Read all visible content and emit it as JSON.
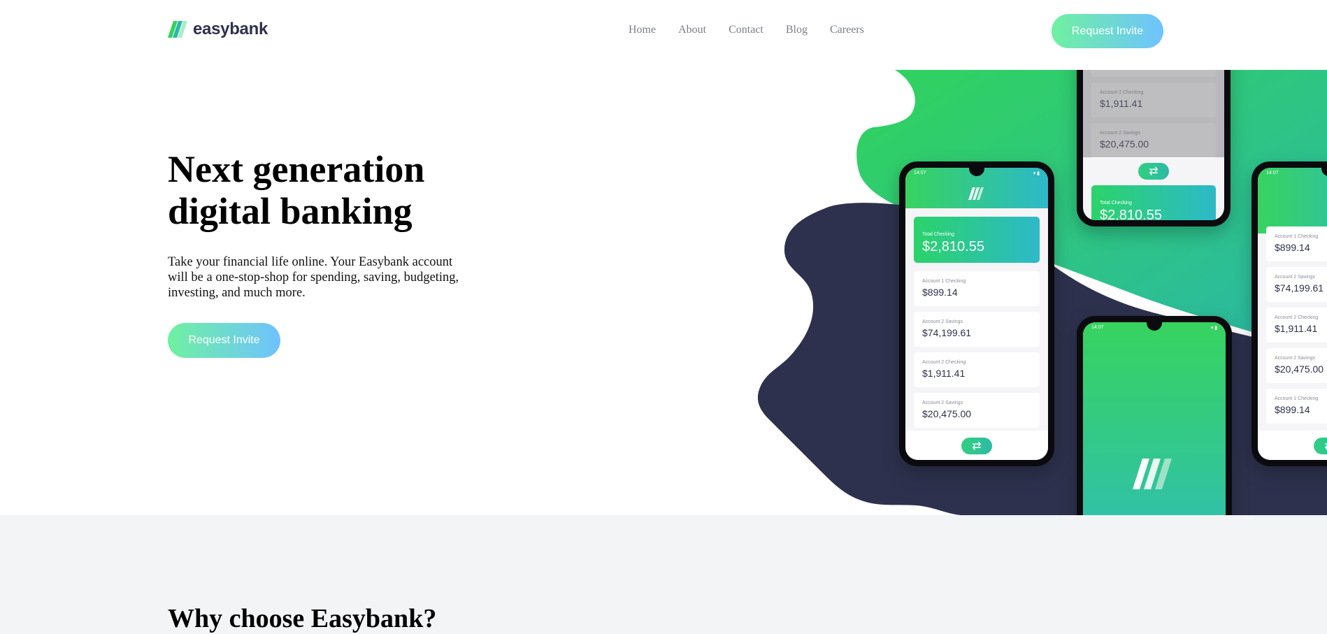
{
  "brand": {
    "name": "easybank",
    "colors": {
      "dark_blue": "#2d314d",
      "lime_green": "#31d35c",
      "bright_cyan": "#2bb7da",
      "grayish_blue": "#7b7d8a",
      "light_gray": "#f3f4f6"
    }
  },
  "nav": {
    "items": [
      "Home",
      "About",
      "Contact",
      "Blog",
      "Careers"
    ]
  },
  "header": {
    "cta_label": "Request Invite"
  },
  "hero": {
    "title": "Next generation digital banking",
    "description": "Take your financial life online. Your Easybank account will be a one-stop-shop for spending, saving, budgeting, investing, and much more.",
    "cta_label": "Request Invite"
  },
  "features": {
    "title": "Why choose Easybank?"
  },
  "mockup": {
    "status_time": "14:07",
    "total_label": "Total Checking",
    "total_amount": "$2,810.55",
    "fab_icon": "transfer-icon",
    "accounts": [
      {
        "label": "Account 1 Checking",
        "amount": "$899.14"
      },
      {
        "label": "Account 2 Savings",
        "amount": "$74,199.61"
      },
      {
        "label": "Account 2 Checking",
        "amount": "$1,911.41"
      },
      {
        "label": "Account 2 Savings",
        "amount": "$20,475.00"
      },
      {
        "label": "Account 1 Checking",
        "amount": "$899.14"
      }
    ]
  }
}
